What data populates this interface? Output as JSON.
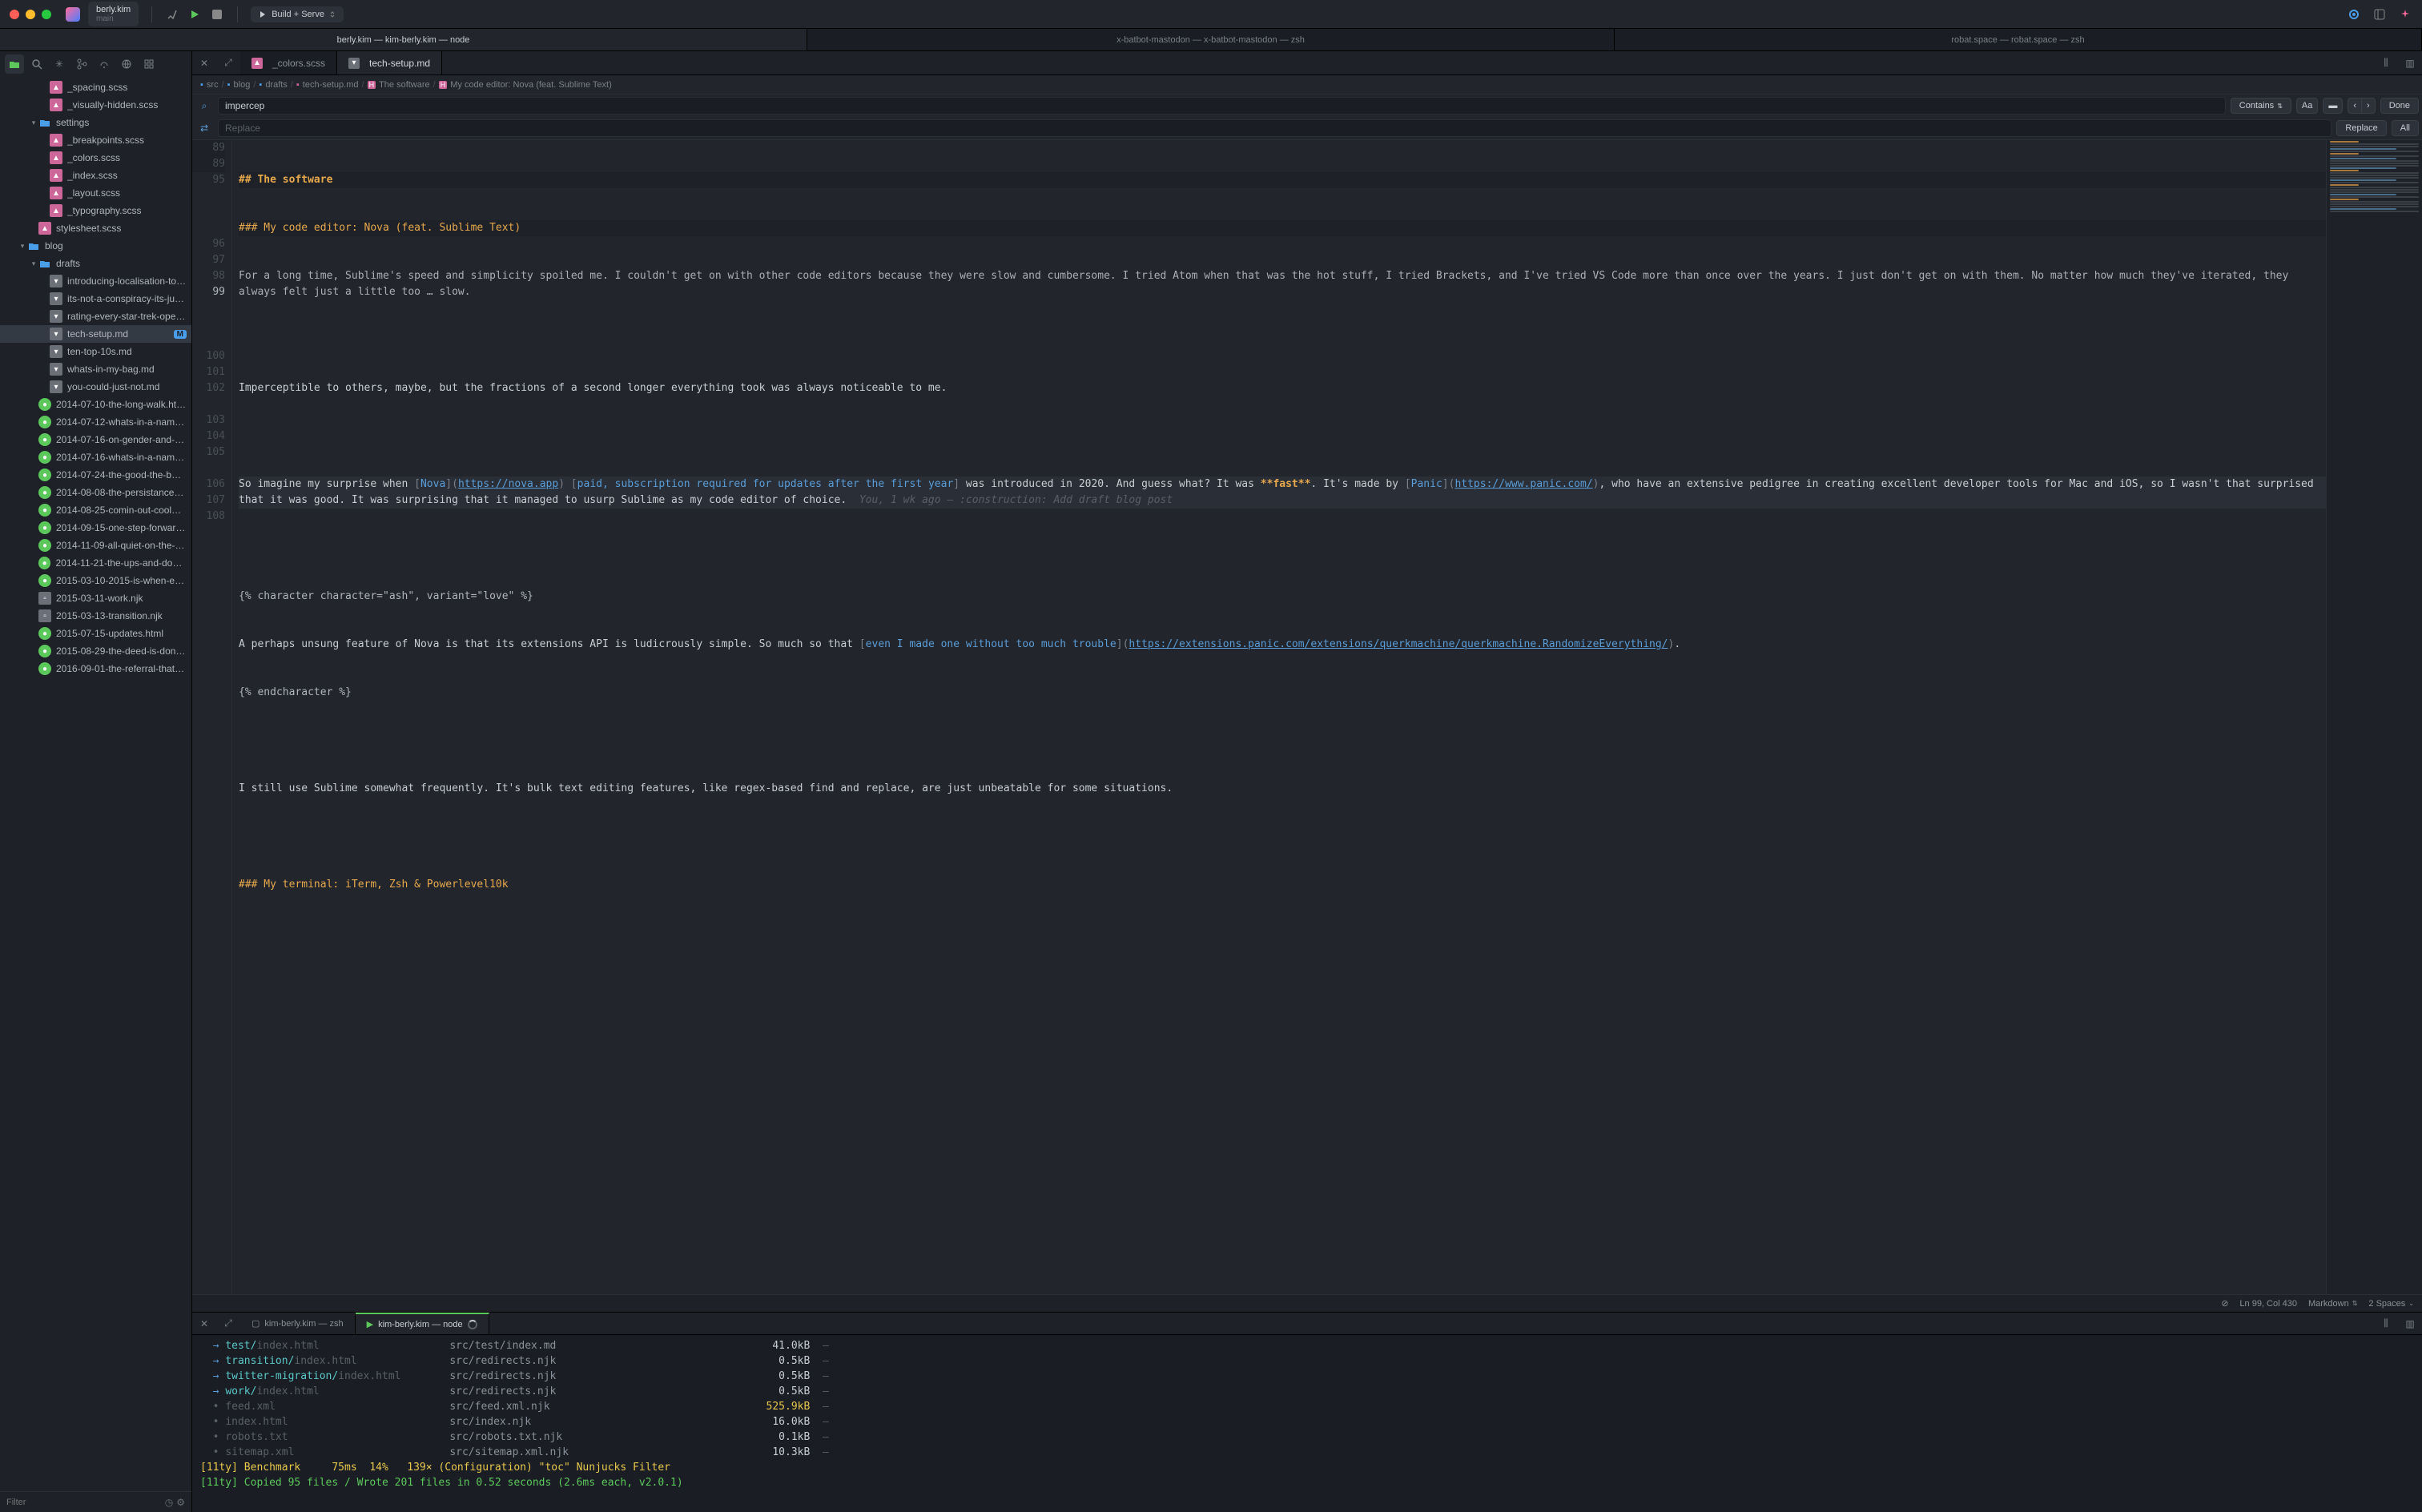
{
  "titlebar": {
    "project_name": "berly.kim",
    "project_branch": "main",
    "run_config": "Build + Serve"
  },
  "window_tabs": [
    "berly.kim — kim-berly.kim — node",
    "x-batbot-mastodon — x-batbot-mastodon — zsh",
    "robat.space — robat.space — zsh"
  ],
  "sidebar": {
    "filter_placeholder": "Filter",
    "tree": [
      {
        "depth": 3,
        "icon": "sass",
        "label": "_spacing.scss"
      },
      {
        "depth": 3,
        "icon": "sass",
        "label": "_visually-hidden.scss"
      },
      {
        "depth": 2,
        "icon": "folder",
        "label": "settings",
        "twist": "down"
      },
      {
        "depth": 3,
        "icon": "sass",
        "label": "_breakpoints.scss"
      },
      {
        "depth": 3,
        "icon": "sass",
        "label": "_colors.scss"
      },
      {
        "depth": 3,
        "icon": "sass",
        "label": "_index.scss"
      },
      {
        "depth": 3,
        "icon": "sass",
        "label": "_layout.scss"
      },
      {
        "depth": 3,
        "icon": "sass",
        "label": "_typography.scss"
      },
      {
        "depth": 2,
        "icon": "sass",
        "label": "stylesheet.scss"
      },
      {
        "depth": 1,
        "icon": "folder",
        "label": "blog",
        "twist": "down"
      },
      {
        "depth": 2,
        "icon": "folder",
        "label": "drafts",
        "twist": "down"
      },
      {
        "depth": 3,
        "icon": "md",
        "label": "introducing-localisation-to…"
      },
      {
        "depth": 3,
        "icon": "md",
        "label": "its-not-a-conspiracy-its-ju…"
      },
      {
        "depth": 3,
        "icon": "md",
        "label": "rating-every-star-trek-ope…"
      },
      {
        "depth": 3,
        "icon": "md",
        "label": "tech-setup.md",
        "selected": true,
        "badge": "M"
      },
      {
        "depth": 3,
        "icon": "md",
        "label": "ten-top-10s.md"
      },
      {
        "depth": 3,
        "icon": "md",
        "label": "whats-in-my-bag.md"
      },
      {
        "depth": 3,
        "icon": "md",
        "label": "you-could-just-not.md"
      },
      {
        "depth": 2,
        "icon": "html",
        "label": "2014-07-10-the-long-walk.ht…"
      },
      {
        "depth": 2,
        "icon": "html",
        "label": "2014-07-12-whats-in-a-nam…"
      },
      {
        "depth": 2,
        "icon": "html",
        "label": "2014-07-16-on-gender-and-…"
      },
      {
        "depth": 2,
        "icon": "html",
        "label": "2014-07-16-whats-in-a-nam…"
      },
      {
        "depth": 2,
        "icon": "html",
        "label": "2014-07-24-the-good-the-b…"
      },
      {
        "depth": 2,
        "icon": "html",
        "label": "2014-08-08-the-persistance…"
      },
      {
        "depth": 2,
        "icon": "html",
        "label": "2014-08-25-comin-out-cool…"
      },
      {
        "depth": 2,
        "icon": "html",
        "label": "2014-09-15-one-step-forwar…"
      },
      {
        "depth": 2,
        "icon": "html",
        "label": "2014-11-09-all-quiet-on-the-…"
      },
      {
        "depth": 2,
        "icon": "html",
        "label": "2014-11-21-the-ups-and-dow…"
      },
      {
        "depth": 2,
        "icon": "html",
        "label": "2015-03-10-2015-is-when-e…"
      },
      {
        "depth": 2,
        "icon": "njk",
        "label": "2015-03-11-work.njk"
      },
      {
        "depth": 2,
        "icon": "njk",
        "label": "2015-03-13-transition.njk"
      },
      {
        "depth": 2,
        "icon": "html",
        "label": "2015-07-15-updates.html"
      },
      {
        "depth": 2,
        "icon": "html",
        "label": "2015-08-29-the-deed-is-don…"
      },
      {
        "depth": 2,
        "icon": "html",
        "label": "2016-09-01-the-referral-that…"
      }
    ]
  },
  "doc_tabs": [
    {
      "label": "_colors.scss",
      "icon": "sass"
    },
    {
      "label": "tech-setup.md",
      "icon": "md",
      "active": true
    }
  ],
  "crumbs": [
    {
      "label": "src",
      "icon": "folder"
    },
    {
      "label": "blog",
      "icon": "folder"
    },
    {
      "label": "drafts",
      "icon": "folder"
    },
    {
      "label": "tech-setup.md",
      "icon": "md"
    },
    {
      "label": "The software",
      "icon": "h"
    },
    {
      "label": "My code editor: Nova (feat. Sublime Text)",
      "icon": "h"
    }
  ],
  "find": {
    "query": "impercep",
    "replace_placeholder": "Replace",
    "mode": "Contains",
    "done": "Done",
    "replace_btn": "Replace",
    "all_btn": "All"
  },
  "editor": {
    "sticky1_ln": "89",
    "sticky1": "## The software",
    "sticky2_ln": "89",
    "sticky2": "### My code editor: Nova (feat. Sublime Text)",
    "l95_ln": "95",
    "l95": "For a long time, Sublime's speed and simplicity spoiled me. I couldn't get on with other code editors because they were slow and cumbersome. I tried Atom when that was the hot stuff, I tried Brackets, and I've tried VS Code more than once over the years. I just don't get on with them. No matter how much they've iterated, they always felt just a little too … slow.",
    "l96_ln": "96",
    "l97_ln": "97",
    "l97": "Imperceptible to others, maybe, but the fractions of a second longer everything took was always noticeable to me.",
    "l98_ln": "98",
    "l99_ln": "99",
    "l99_a": "So imagine my surprise when ",
    "l99_nova": "Nova",
    "l99_novaurl": "https://nova.app",
    "l99_b": " ",
    "l99_paid": "paid, subscription required for updates after the first year",
    "l99_c": " was introduced in 2020. And guess what? It was ",
    "l99_fast": "**fast**",
    "l99_d": ". It's made by ",
    "l99_panic": "Panic",
    "l99_panicurl": "https://www.panic.com/",
    "l99_e": ", who have an extensive pedigree in creating excellent developer tools for Mac and iOS, so I wasn't that surprised that it was good. It was surprising that it managed to usurp Sublime as my code editor of choice.",
    "l99_blame": "  You, 1 wk ago — :construction: Add draft blog post",
    "l100_ln": "100",
    "l101_ln": "101",
    "l101": "{% character character=\"ash\", variant=\"love\" %}",
    "l102_ln": "102",
    "l102_a": "A perhaps unsung feature of Nova is that its extensions API is ludicrously simple. So much so that ",
    "l102_ext": "even I made one without too much trouble",
    "l102_exturl": "https://extensions.panic.com/extensions/querkmachine/querkmachine.RandomizeEverything/",
    "l102_b": ".",
    "l103_ln": "103",
    "l103": "{% endcharacter %}",
    "l104_ln": "104",
    "l105_ln": "105",
    "l105": "I still use Sublime somewhat frequently. It's bulk text editing features, like regex-based find and replace, are just unbeatable for some situations.",
    "l106_ln": "106",
    "l107_ln": "107",
    "l107": "### My terminal: iTerm, Zsh & Powerlevel10k",
    "l108_ln": "108"
  },
  "status": {
    "pos": "Ln 99, Col 430",
    "lang": "Markdown",
    "indent": "2 Spaces"
  },
  "term_tabs": [
    {
      "label": "kim-berly.kim — zsh"
    },
    {
      "label": "kim-berly.kim — node",
      "active": true,
      "spinner": true
    }
  ],
  "terminal": {
    "rows": [
      {
        "arrow": true,
        "path_a": "test/",
        "path_b": "index.html",
        "src": "src/test/index.md",
        "size": "41.0kB"
      },
      {
        "arrow": true,
        "path_a": "transition/",
        "path_b": "index.html",
        "src": "src/redirects.njk",
        "size": "0.5kB"
      },
      {
        "arrow": true,
        "path_a": "twitter-migration/",
        "path_b": "index.html",
        "src": "src/redirects.njk",
        "size": "0.5kB"
      },
      {
        "arrow": true,
        "path_a": "work/",
        "path_b": "index.html",
        "src": "src/redirects.njk",
        "size": "0.5kB"
      },
      {
        "bullet": true,
        "path_b": "feed.xml",
        "src": "src/feed.xml.njk",
        "size": "525.9kB",
        "sizey": true
      },
      {
        "bullet": true,
        "path_b": "index.html",
        "src": "src/index.njk",
        "size": "16.0kB"
      },
      {
        "bullet": true,
        "path_b": "robots.txt",
        "src": "src/robots.txt.njk",
        "size": "0.1kB"
      },
      {
        "bullet": true,
        "path_b": "sitemap.xml",
        "src": "src/sitemap.xml.njk",
        "size": "10.3kB"
      }
    ],
    "bench": "[11ty] Benchmark     75ms  14%   139× (Configuration) \"toc\" Nunjucks Filter",
    "done": "[11ty] Copied 95 files / Wrote 201 files in 0.52 seconds (2.6ms each, v2.0.1)"
  }
}
